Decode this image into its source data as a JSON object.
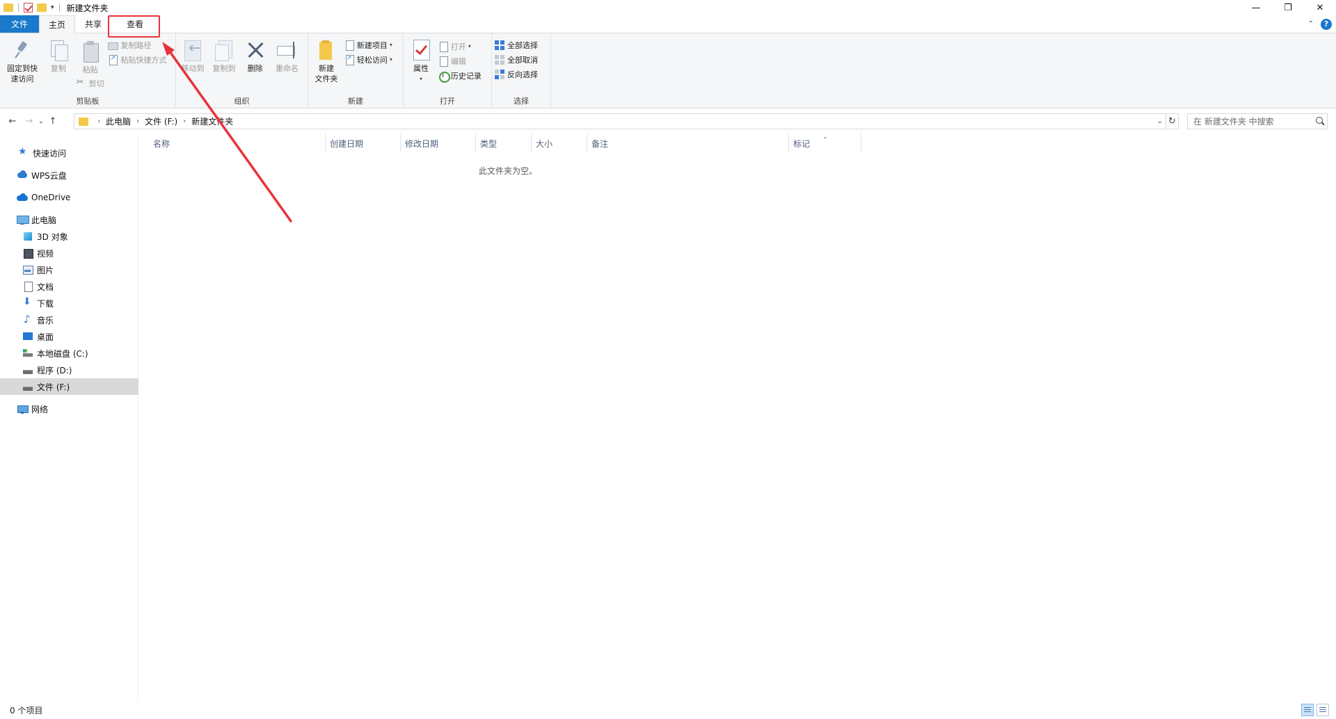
{
  "window": {
    "title": "新建文件夹",
    "minimize_glyph": "—",
    "maximize_glyph": "❐",
    "close_glyph": "✕"
  },
  "quick_access_toolbar": {
    "dropdown_glyph": "▾"
  },
  "ribbon_tabs": {
    "file": "文件",
    "home": "主页",
    "share": "共享",
    "view": "查看",
    "collapse_glyph": "⌃",
    "help_glyph": "?"
  },
  "ribbon": {
    "clipboard": {
      "label": "剪贴板",
      "pin_to_quick_access_line1": "固定到快",
      "pin_to_quick_access_line2": "速访问",
      "copy": "复制",
      "paste": "粘贴",
      "copy_path": "复制路径",
      "paste_shortcut": "粘贴快捷方式",
      "cut": "剪切"
    },
    "organize": {
      "label": "组织",
      "move_to": "移动到",
      "copy_to": "复制到",
      "delete": "删除",
      "rename": "重命名"
    },
    "new": {
      "label": "新建",
      "new_folder_line1": "新建",
      "new_folder_line2": "文件夹",
      "new_item": "新建项目",
      "easy_access": "轻松访问"
    },
    "open": {
      "label": "打开",
      "properties": "属性",
      "open": "打开",
      "edit": "编辑",
      "history": "历史记录"
    },
    "select": {
      "label": "选择",
      "select_all": "全部选择",
      "select_none": "全部取消",
      "invert_selection": "反向选择"
    }
  },
  "navigation": {
    "back_glyph": "←",
    "forward_glyph": "→",
    "recent_glyph": "⌄",
    "up_glyph": "↑",
    "breadcrumb": [
      "此电脑",
      "文件 (F:)",
      "新建文件夹"
    ],
    "crumb_separator": "›",
    "dropdown_glyph": "⌄",
    "refresh_glyph": "↻",
    "search_placeholder": "在 新建文件夹 中搜索"
  },
  "sidebar": {
    "quick_access": "快速访问",
    "wps_cloud": "WPS云盘",
    "onedrive": "OneDrive",
    "this_pc": "此电脑",
    "pc_items": [
      "3D 对象",
      "视频",
      "图片",
      "文档",
      "下载",
      "音乐",
      "桌面",
      "本地磁盘 (C:)",
      "程序 (D:)",
      "文件 (F:)"
    ],
    "network": "网络"
  },
  "file_list": {
    "columns": [
      "名称",
      "创建日期",
      "修改日期",
      "类型",
      "大小",
      "备注",
      "标记"
    ],
    "sort_glyph": "⌄",
    "empty_message": "此文件夹为空。"
  },
  "status_bar": {
    "item_count": "0 个项目"
  },
  "colors": {
    "file_tab_bg": "#1979ca",
    "annotation_red": "#e8323a",
    "folder_yellow": "#f4c84a",
    "selected_nav_bg": "#d9d9d9"
  }
}
